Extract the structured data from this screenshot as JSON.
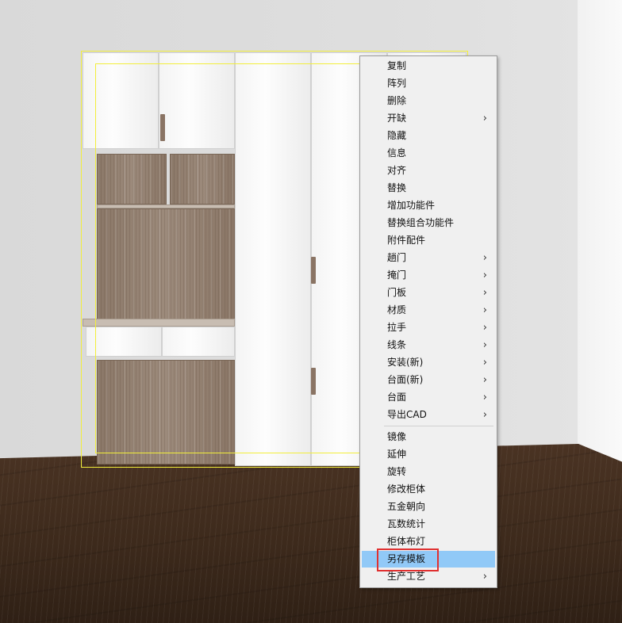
{
  "menu": {
    "items": [
      {
        "label": "复制",
        "submenu": false
      },
      {
        "label": "阵列",
        "submenu": false
      },
      {
        "label": "删除",
        "submenu": false
      },
      {
        "label": "开缺",
        "submenu": true
      },
      {
        "label": "隐藏",
        "submenu": false
      },
      {
        "label": "信息",
        "submenu": false
      },
      {
        "label": "对齐",
        "submenu": false
      },
      {
        "label": "替换",
        "submenu": false
      },
      {
        "label": "增加功能件",
        "submenu": false
      },
      {
        "label": "替换组合功能件",
        "submenu": false
      },
      {
        "label": "附件配件",
        "submenu": false
      },
      {
        "label": "趟门",
        "submenu": true
      },
      {
        "label": "掩门",
        "submenu": true
      },
      {
        "label": "门板",
        "submenu": true
      },
      {
        "label": "材质",
        "submenu": true
      },
      {
        "label": "拉手",
        "submenu": true
      },
      {
        "label": "线条",
        "submenu": true
      },
      {
        "label": "安装(新)",
        "submenu": true
      },
      {
        "label": "台面(新)",
        "submenu": true
      },
      {
        "label": "台面",
        "submenu": true
      },
      {
        "label": "导出CAD",
        "submenu": true
      }
    ],
    "items2": [
      {
        "label": "镜像",
        "submenu": false
      },
      {
        "label": "延伸",
        "submenu": false
      },
      {
        "label": "旋转",
        "submenu": false
      },
      {
        "label": "修改柜体",
        "submenu": false
      },
      {
        "label": "五金朝向",
        "submenu": false
      },
      {
        "label": "瓦数统计",
        "submenu": false
      },
      {
        "label": "柜体布灯",
        "submenu": false
      },
      {
        "label": "另存模板",
        "submenu": false,
        "hovered": true
      },
      {
        "label": "生产工艺",
        "submenu": true
      }
    ],
    "chevron": "›"
  },
  "colors": {
    "hover": "#91c9f7",
    "highlight": "#e03030",
    "selection": "#f2ee3a"
  }
}
